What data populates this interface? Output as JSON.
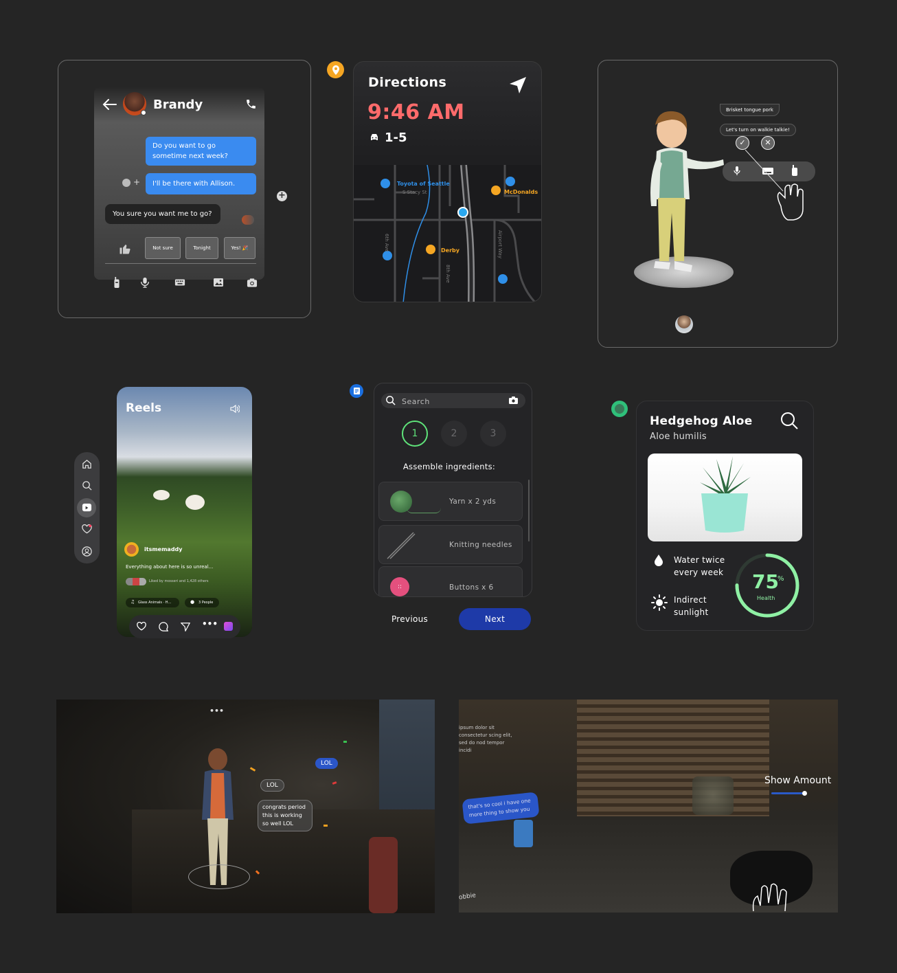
{
  "messenger": {
    "contact_name": "Brandy",
    "messages": [
      {
        "text": "Do you want to go sometime next week?",
        "from": "me"
      },
      {
        "text": "I'll be there with Allison.",
        "from": "me"
      },
      {
        "text": "You sure you want me to go?",
        "from": "them"
      }
    ],
    "quick_replies": [
      "Not sure",
      "Tonight",
      "Yes! 🎉"
    ]
  },
  "directions": {
    "title": "Directions",
    "time": "9:46 AM",
    "route": "1-5",
    "accent_color": "#ff6b6b",
    "map_labels": {
      "toyota": "Toyota of Seattle",
      "stacy": "S Stacy St",
      "mcdonalds": "McDonalds",
      "derby": "Derby",
      "sixth": "6th Ave",
      "eighth": "8th Ave",
      "airport": "Airport Way"
    }
  },
  "avatar_card": {
    "chat_lines": [
      "Brisket tongue pork",
      "Let's turn on walkie talkie!"
    ]
  },
  "reels": {
    "title": "Reels",
    "username": "itsmemaddy",
    "caption": "Everything about here is so unreal...",
    "likes": "Liked by mosseri and 1,428 others",
    "audio": "Glass Animals · H...",
    "people": "3 People"
  },
  "knitting": {
    "search_placeholder": "Search",
    "steps": [
      "1",
      "2",
      "3"
    ],
    "heading": "Assemble ingredients:",
    "ingredients": [
      "Yarn x 2 yds",
      "Knitting needles",
      "Buttons x 6"
    ],
    "previous_label": "Previous",
    "next_label": "Next"
  },
  "plant": {
    "name": "Hedgehog Aloe",
    "latin": "Aloe humilis",
    "water_line1": "Water twice",
    "water_line2": "every week",
    "light_line1": "Indirect",
    "light_line2": "sunlight",
    "health_value": "75",
    "health_unit": "%",
    "health_label": "Health",
    "health_fraction": 0.75,
    "ring_color": "#8ff0a4"
  },
  "mr_scene_1": {
    "bubbles": [
      "LOL",
      "LOL",
      "congrats period this is working so well LOL"
    ],
    "menu": "•••"
  },
  "mr_scene_2": {
    "lorem": "ipsum dolor sit consectetur scing elit, sed do nod tempor incidi",
    "chat_bubble": "that's so cool i have one more thing to show you",
    "show_amount": "Show Amount",
    "user_label": "obbie"
  }
}
